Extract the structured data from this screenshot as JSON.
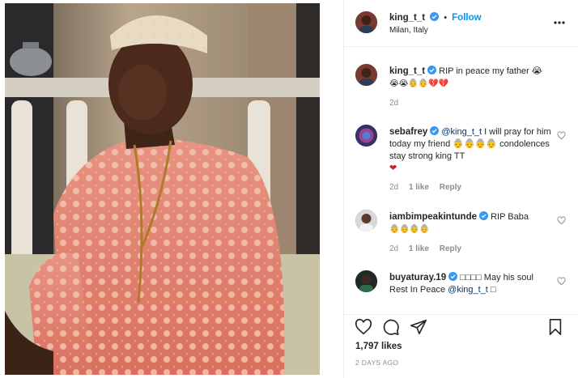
{
  "post": {
    "username": "king_t_t",
    "follow_label": "Follow",
    "separator": "•",
    "location": "Milan, Italy"
  },
  "comments": [
    {
      "username": "king_t_t",
      "text": "RIP in peace my father 😭",
      "text2": "😭😭👵👵💔💔",
      "time": "2d"
    },
    {
      "username": "sebafrey",
      "mention": "@king_t_t",
      "text": "I will pray for him today my friend 👵👵👵👵 condolences stay strong king TT",
      "text2": "❤",
      "time": "2d",
      "likes": "1 like",
      "reply": "Reply"
    },
    {
      "username": "iambimpeakintunde",
      "text": "RIP Baba",
      "text2": "👵👵👵👵",
      "time": "2d",
      "likes": "1 like",
      "reply": "Reply"
    },
    {
      "username": "buyaturay.19",
      "text": "□□□□ May his soul Rest In Peace",
      "mention": "@king_t_t",
      "text2": "□"
    }
  ],
  "footer": {
    "likes": "1,797 likes",
    "time": "2 DAYS AGO"
  },
  "icons": {
    "verified": "verified-badge-icon",
    "more": "more-options-icon",
    "like": "heart-icon",
    "comment": "comment-icon",
    "share": "paper-plane-icon",
    "save": "bookmark-icon"
  },
  "colors": {
    "link_blue": "#0095f6",
    "mention": "#00376b",
    "secondary_text": "#8e8e8e",
    "verified": "#3897f0"
  }
}
